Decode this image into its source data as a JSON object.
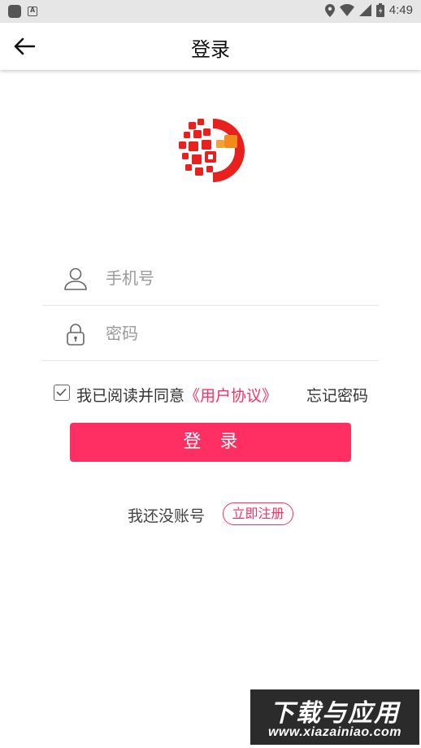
{
  "status_bar": {
    "time": "4:49",
    "icons": [
      "app-square-icon",
      "a-notification-icon",
      "location-icon",
      "wifi-icon",
      "signal-icon",
      "battery-icon"
    ]
  },
  "header": {
    "title": "登录",
    "back_icon": "arrow-left-icon"
  },
  "logo": {
    "icon": "app-logo-icon",
    "colors": {
      "red": "#e8201e",
      "orange": "#f28a1e"
    }
  },
  "form": {
    "phone_placeholder": "手机号",
    "phone_value": "",
    "password_placeholder": "密码",
    "password_value": ""
  },
  "agreement": {
    "checked": true,
    "prefix": "我已阅读并同意",
    "link": "《用户协议》",
    "forgot_password": "忘记密码"
  },
  "login_button": "登 录",
  "register": {
    "prompt": "我还没账号",
    "button": "立即注册"
  },
  "watermark": {
    "top": "下载与应用",
    "bottom": "www.xiazainiao.com"
  },
  "colors": {
    "accent": "#ff2f63",
    "text": "#333333",
    "placeholder": "#9a9a9a",
    "divider": "#e8e8e8"
  }
}
